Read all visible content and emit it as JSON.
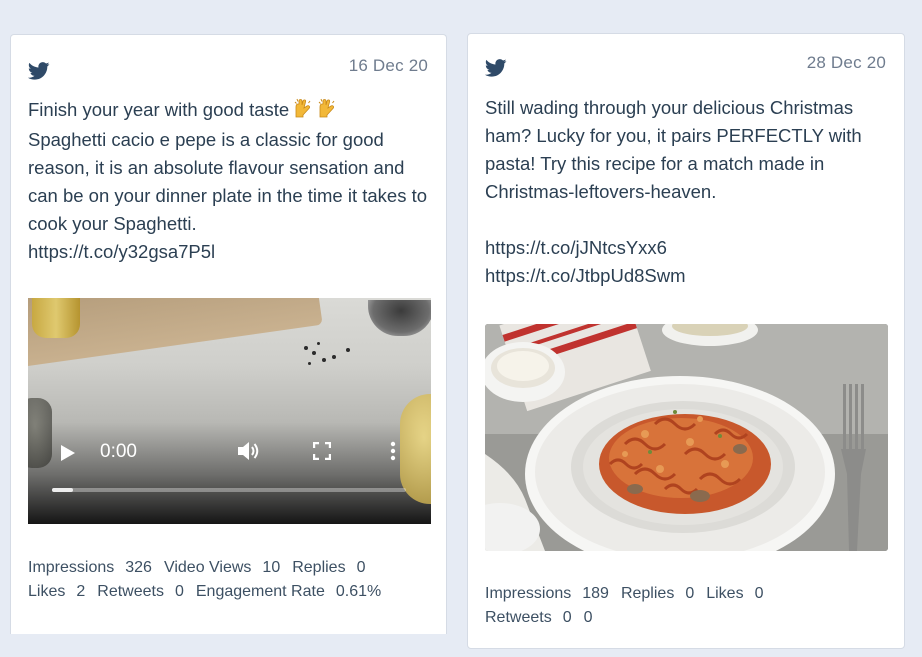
{
  "colors": {
    "background": "#e6ebf4",
    "card": "#ffffff",
    "text": "#2b3f52",
    "date": "#6f7c8e",
    "twitter_icon": "#2f4a68"
  },
  "posts": [
    {
      "icon": "twitter-bird-icon",
      "date": "16 Dec 20",
      "text": "Finish your year with good taste",
      "emoji": "raising-hands-emoji",
      "text_rest": "Spaghetti cacio e pepe is a classic for good reason, it is an absolute flavour sensation and can be on your dinner plate in the time it takes to cook your Spaghetti.\nhttps://t.co/y32gsa7P5l",
      "media": {
        "type": "video",
        "time": "0:00",
        "progress": 0.06
      },
      "stats": [
        {
          "label": "Impressions",
          "value": "326"
        },
        {
          "label": "Video Views",
          "value": "10"
        },
        {
          "label": "Replies",
          "value": "0"
        },
        {
          "label": "Likes",
          "value": "2"
        },
        {
          "label": "Retweets",
          "value": "0"
        },
        {
          "label": "Engagement Rate",
          "value": "0.61%"
        }
      ]
    },
    {
      "icon": "twitter-bird-icon",
      "date": "28 Dec 20",
      "text": "Still wading through your delicious Christmas ham? Lucky for you, it pairs PERFECTLY with pasta! Try this recipe for a match made in Christmas-leftovers-heaven.\n\nhttps://t.co/jJNtcsYxx6\nhttps://t.co/JtbpUd8Swm",
      "media": {
        "type": "image",
        "subject": "pasta-dish-photo"
      },
      "stats": [
        {
          "label": "Impressions",
          "value": "189"
        },
        {
          "label": "Replies",
          "value": "0"
        },
        {
          "label": "Likes",
          "value": "0"
        },
        {
          "label": "Retweets",
          "value": "0"
        },
        {
          "label": "",
          "value": "0"
        }
      ]
    }
  ]
}
